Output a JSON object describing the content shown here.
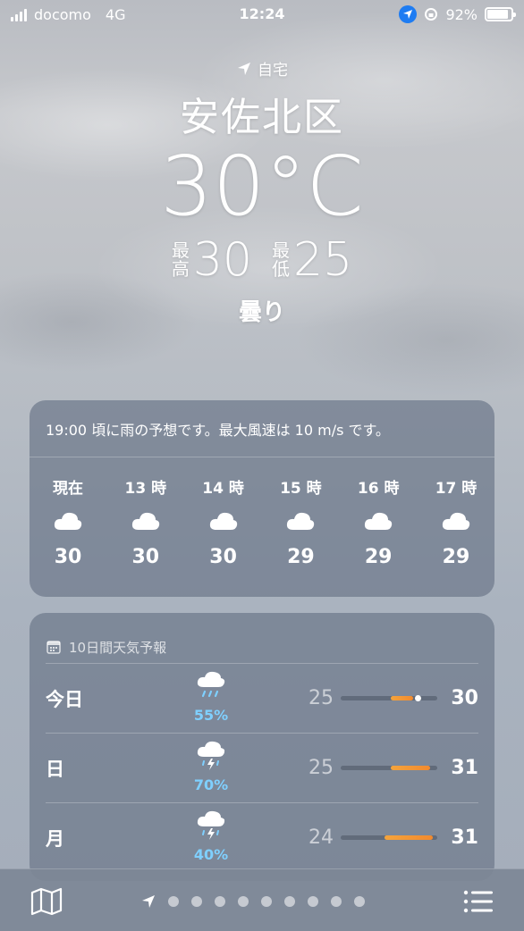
{
  "status": {
    "carrier": "docomo",
    "network": "4G",
    "time": "12:24",
    "battery": "92%"
  },
  "header": {
    "home_label": "自宅",
    "city": "安佐北区",
    "temperature": "30°C",
    "high_label_top": "最",
    "high_label_bottom": "高",
    "high": "30",
    "low_label_top": "最",
    "low_label_bottom": "低",
    "low": "25",
    "condition": "曇り"
  },
  "hourly": {
    "summary": "19:00 頃に雨の予想です。最大風速は 10 m/s です。",
    "items": [
      {
        "hour": "現在",
        "icon": "cloud-icon",
        "temp": "30"
      },
      {
        "hour": "13 時",
        "icon": "cloud-icon",
        "temp": "30"
      },
      {
        "hour": "14 時",
        "icon": "cloud-icon",
        "temp": "30"
      },
      {
        "hour": "15 時",
        "icon": "cloud-icon",
        "temp": "29"
      },
      {
        "hour": "16 時",
        "icon": "cloud-icon",
        "temp": "29"
      },
      {
        "hour": "17 時",
        "icon": "cloud-icon",
        "temp": "29"
      }
    ]
  },
  "daily": {
    "title": "10日間天気予報",
    "rows": [
      {
        "day": "今日",
        "icon": "cloud-rain-icon",
        "precip": "55%",
        "low": "25",
        "high": "30",
        "range_start": 0.52,
        "range_end": 0.75,
        "current": 0.8
      },
      {
        "day": "日",
        "icon": "cloud-thunderstorm-icon",
        "precip": "70%",
        "low": "25",
        "high": "31",
        "range_start": 0.52,
        "range_end": 0.93
      },
      {
        "day": "月",
        "icon": "cloud-thunderstorm-icon",
        "precip": "40%",
        "low": "24",
        "high": "31",
        "range_start": 0.45,
        "range_end": 0.95
      }
    ]
  },
  "toolbar": {
    "page_count": 9
  },
  "colors": {
    "accent_orange": "#f28a2e",
    "precip_blue": "#7fd0ff",
    "location_blue": "#1e7cf2"
  }
}
